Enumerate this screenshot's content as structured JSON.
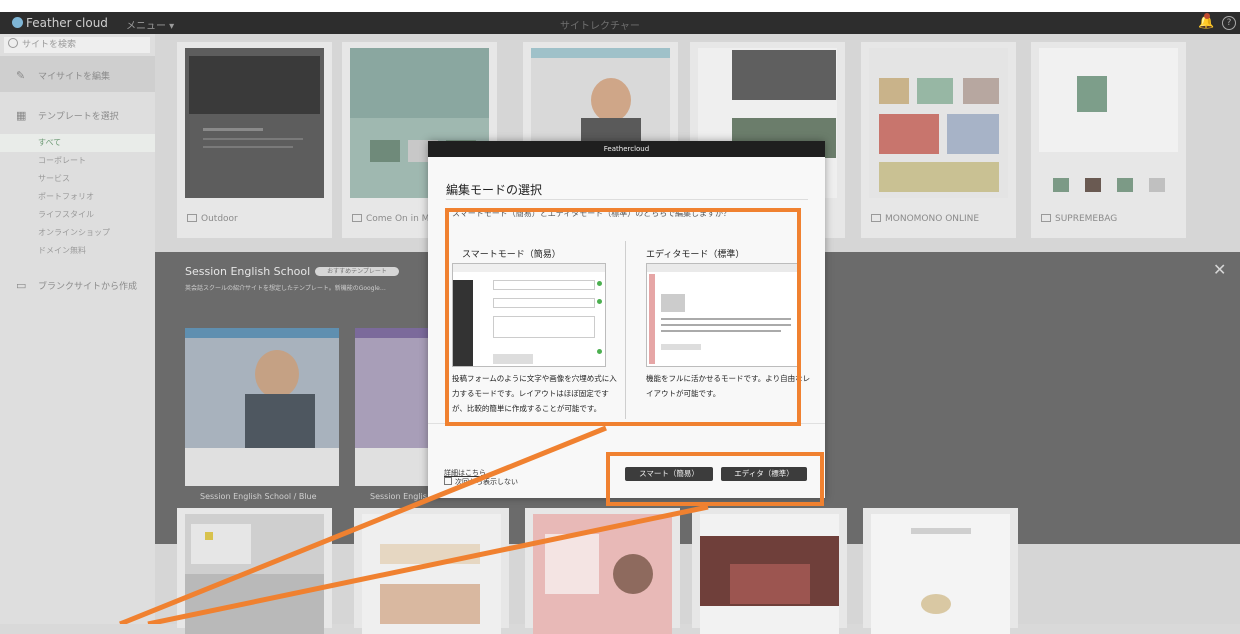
{
  "topbar": {
    "logo": "Feather cloud",
    "menu": "メニュー ▾",
    "title": "サイトレクチャー"
  },
  "sidebar": {
    "search_placeholder": "サイトを検索",
    "my_sites": "マイサイトを編集",
    "choose_template": "テンプレートを選択",
    "categories": [
      "すべて",
      "コーポレート",
      "サービス",
      "ポートフォリオ",
      "ライフスタイル",
      "オンラインショップ",
      "ドメイン無料"
    ],
    "create_blank": "ブランクサイトから作成"
  },
  "gallery": {
    "row1": [
      "Outdoor",
      "Come On in My House!",
      "",
      "",
      "",
      "MONOMONO ONLINE",
      "SUPREMEBAG"
    ],
    "expanded": {
      "title": "Session English School",
      "tag": "おすすめテンプレート",
      "description": "英会話スクールの紹介サイトを想定したテンプレート。新機能のGoogle…",
      "variants": [
        "Session English School / Blue",
        "Session English School / Purple"
      ]
    },
    "row3_thumbs": [
      "yellow-notebook",
      "market",
      "pink-kitchen",
      "wine-grapes",
      "jewelry"
    ]
  },
  "modal": {
    "header": "Feathercloud",
    "title": "編集モードの選択",
    "question": "スマートモード（簡易）とエディタモード（標準）のどちらで編集しますか？",
    "smart": {
      "title": "スマートモード（簡易）",
      "desc": "投稿フォームのように文字や画像を穴埋め式に入力するモードです。レイアウトはほぼ固定ですが、比較的簡単に作成することが可能です。"
    },
    "editor": {
      "title": "エディタモード（標準）",
      "desc": "機能をフルに活かせるモードです。より自由なレイアウトが可能です。"
    },
    "details_link": "詳細はこちら",
    "dont_show": "次回から表示しない",
    "btn_smart": "スマート（簡易）",
    "btn_editor": "エディタ（標準）"
  },
  "colors": {
    "highlight": "#f08130",
    "modal_header": "#1f1f1f",
    "button_dark": "#3c3c3c",
    "sidebar_active": "#6f9b76"
  }
}
